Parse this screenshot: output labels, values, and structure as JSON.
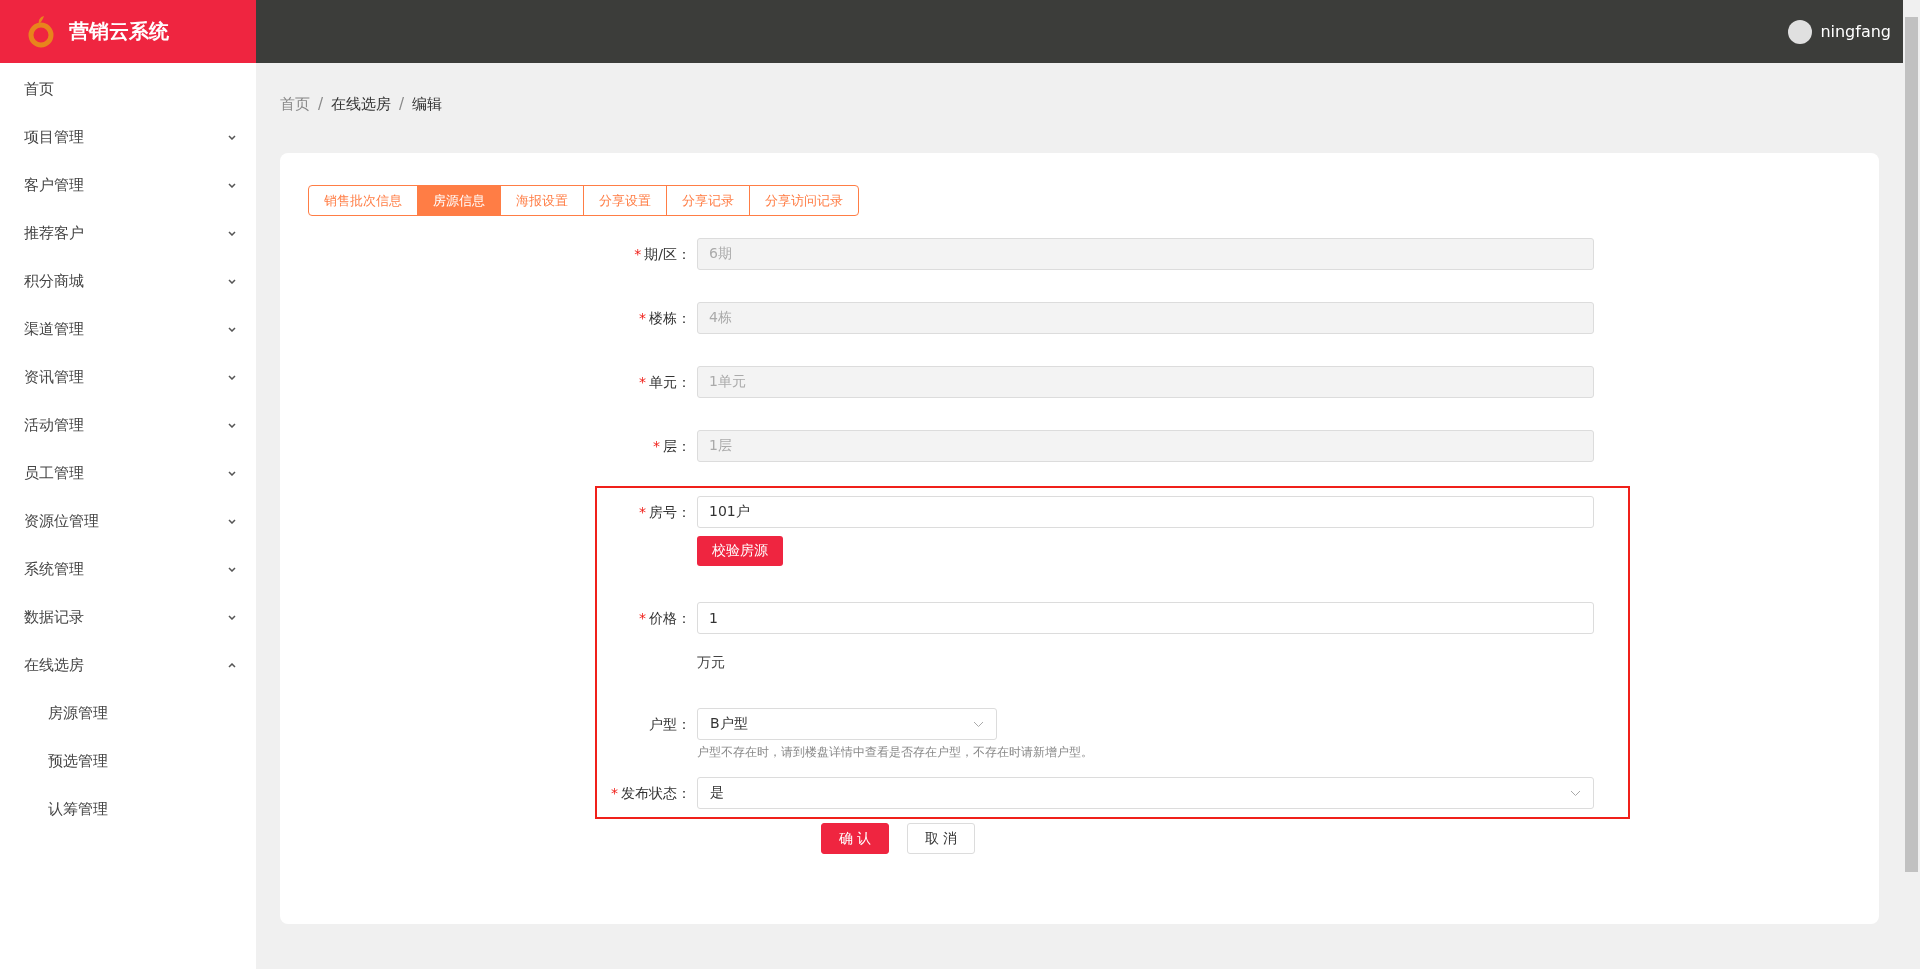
{
  "header": {
    "logo_text": "营销云系统",
    "username": "ningfang"
  },
  "sidebar": {
    "items": [
      {
        "label": "首页",
        "expandable": false,
        "selected": false
      },
      {
        "label": "项目管理",
        "expandable": true,
        "expanded": false,
        "selected": false
      },
      {
        "label": "客户管理",
        "expandable": true,
        "expanded": false,
        "selected": false
      },
      {
        "label": "推荐客户",
        "expandable": true,
        "expanded": false,
        "selected": false
      },
      {
        "label": "积分商城",
        "expandable": true,
        "expanded": false,
        "selected": false
      },
      {
        "label": "渠道管理",
        "expandable": true,
        "expanded": false,
        "selected": false
      },
      {
        "label": "资讯管理",
        "expandable": true,
        "expanded": false,
        "selected": false
      },
      {
        "label": "活动管理",
        "expandable": true,
        "expanded": false,
        "selected": false
      },
      {
        "label": "员工管理",
        "expandable": true,
        "expanded": false,
        "selected": false
      },
      {
        "label": "资源位管理",
        "expandable": true,
        "expanded": false,
        "selected": false
      },
      {
        "label": "系统管理",
        "expandable": true,
        "expanded": false,
        "selected": false
      },
      {
        "label": "数据记录",
        "expandable": true,
        "expanded": false,
        "selected": false
      },
      {
        "label": "在线选房",
        "expandable": true,
        "expanded": true,
        "selected": false,
        "children": [
          {
            "label": "房源管理",
            "selected": false
          },
          {
            "label": "预选管理",
            "selected": false
          },
          {
            "label": "认筹管理",
            "selected": false
          }
        ]
      }
    ]
  },
  "breadcrumb": [
    {
      "label": "首页",
      "link": true
    },
    {
      "label": "在线选房",
      "link": false
    },
    {
      "label": "编辑",
      "link": false
    }
  ],
  "breadcrumb_separator": "/",
  "tabs": [
    {
      "label": "销售批次信息",
      "selected": false
    },
    {
      "label": "房源信息",
      "selected": true
    },
    {
      "label": "海报设置",
      "selected": false
    },
    {
      "label": "分享设置",
      "selected": false
    },
    {
      "label": "分享记录",
      "selected": false
    },
    {
      "label": "分享访问记录",
      "selected": false
    }
  ],
  "form": {
    "required_mark": "*",
    "sections": [
      {
        "fields": [
          {
            "kind": "input",
            "label": "期/区：",
            "required": true,
            "disabled": true,
            "value": "6期"
          },
          {
            "kind": "input",
            "label": "楼栋：",
            "required": true,
            "disabled": true,
            "value": "4栋"
          },
          {
            "kind": "input",
            "label": "单元：",
            "required": true,
            "disabled": true,
            "value": "1单元"
          },
          {
            "kind": "input",
            "label": "层：",
            "required": true,
            "disabled": true,
            "value": "1层"
          }
        ]
      },
      {
        "highlighted": true,
        "fields": [
          {
            "kind": "input",
            "label": "房号：",
            "required": true,
            "disabled": false,
            "value": "101户",
            "action_button": "校验房源"
          },
          {
            "kind": "input",
            "label": "价格：",
            "required": true,
            "disabled": false,
            "value": "1",
            "unit": "万元"
          },
          {
            "kind": "compact_select",
            "label": "户型：",
            "required": false,
            "disabled": false,
            "value": "B户型",
            "hint": "户型不存在时，请到楼盘详情中查看是否存在户型，不存在时请新增户型。"
          },
          {
            "kind": "select",
            "label": "发布状态：",
            "required": true,
            "disabled": false,
            "value": "是"
          }
        ]
      }
    ],
    "buttons": [
      {
        "label": "确 认",
        "kind": "primary"
      },
      {
        "label": "取 消",
        "kind": "default"
      }
    ]
  }
}
